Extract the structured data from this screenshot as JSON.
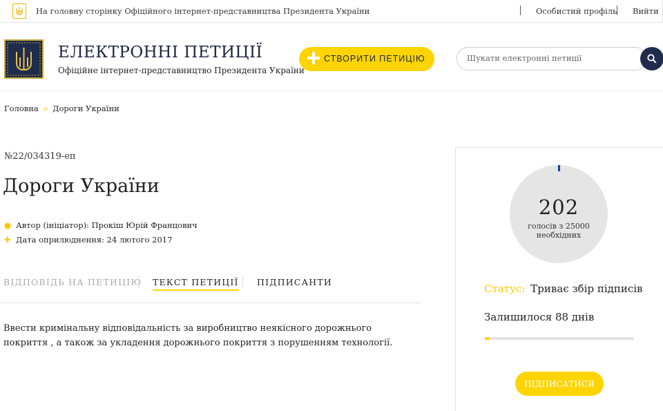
{
  "topbar": {
    "home_link": "На головну сторінку Офіційного інтернет-представництва Президента України",
    "profile_link": "Особистий профіль",
    "logout_link": "Вийти"
  },
  "header": {
    "title": "ЕЛЕКТРОННІ ПЕТИЦІЇ",
    "subtitle": "Офіційне інтернет-представництво Президента України",
    "create_button": "СТВОРИТИ ПЕТИЦІЮ",
    "search_placeholder": "Шукати електронні петиції"
  },
  "breadcrumb": {
    "home": "Головна",
    "current": "Дороги України"
  },
  "petition": {
    "number": "№22/034319-еп",
    "title": "Дороги України",
    "author": "Автор (ініціатор): Прокіш Юрій Францович",
    "published": "Дата оприлюднення: 24 лютого 2017",
    "text": "Ввести кримінальну відповідальність за виробництво неякісного дорожнього покриття , а також за укладення дорожнього покриття з порушенням технології."
  },
  "tabs": [
    {
      "label": "ВІДПОВІДЬ НА ПЕТИЦІЮ"
    },
    {
      "label": "ТЕКСТ ПЕТИЦІЇ"
    },
    {
      "label": "ПІДПИСАНТИ"
    }
  ],
  "panel": {
    "votes": "202",
    "votes_sub_line1": "голосів з 25000",
    "votes_sub_line2": "необхідних",
    "status_label": "Статус:",
    "status_value": "Триває збір підписів",
    "remaining": "Залишилося 88 днів",
    "progress_fraction": 0.03,
    "sign_button": "ПІДПИСАТИСЯ"
  },
  "colors": {
    "accent_yellow": "#ffd400",
    "navy": "#1f2c4b"
  },
  "icons": {
    "author": "user-icon",
    "date": "plus-icon",
    "search": "search-icon"
  }
}
